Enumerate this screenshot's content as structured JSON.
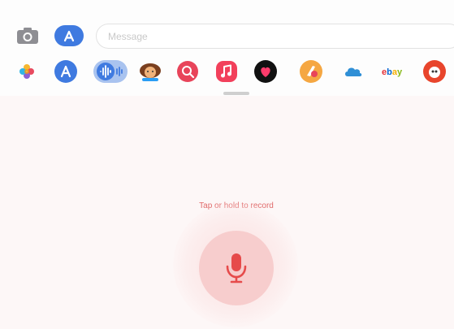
{
  "message_input": {
    "placeholder": "Message"
  },
  "apps": [
    {
      "icon": "photos-icon"
    },
    {
      "icon": "app-store-icon"
    },
    {
      "icon": "audio-message-icon"
    },
    {
      "icon": "memoji-stickers-icon"
    },
    {
      "icon": "image-search-icon"
    },
    {
      "icon": "music-icon"
    },
    {
      "icon": "digital-touch-icon"
    },
    {
      "icon": "game-app-icon"
    },
    {
      "icon": "cloud-app-icon"
    },
    {
      "icon": "ebay-icon",
      "label": "ebay"
    },
    {
      "icon": "sticker-app-icon"
    }
  ],
  "recorder": {
    "hint": "Tap or hold to record",
    "accent": "#e64b4b"
  }
}
